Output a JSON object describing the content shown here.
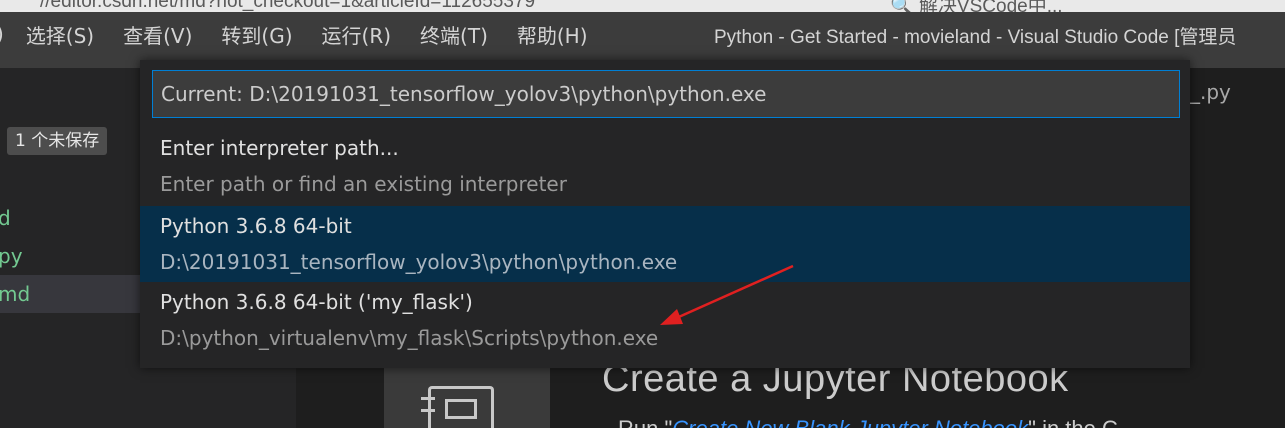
{
  "browser_strip": {
    "ghost_left": "//editor.csdn.net/md?not_checkout=1&articleId=112655379",
    "ghost_right": "🔍  解决VSCode中..."
  },
  "menubar": {
    "items": [
      ")",
      "选择(S)",
      "查看(V)",
      "转到(G)",
      "运行(R)",
      "终端(T)",
      "帮助(H)"
    ]
  },
  "window": {
    "title": "Python - Get Started - movieland - Visual Studio Code [管理员"
  },
  "sidebar": {
    "unsaved_badge": "1 个未保存",
    "files": [
      {
        "label": "d",
        "active": false
      },
      {
        "label": "py",
        "active": false
      },
      {
        "label": "md",
        "active": true
      }
    ]
  },
  "editor": {
    "tab_fragment": "_.py",
    "welcome_heading": "Create a Jupyter Notebook",
    "welcome_subline_prefix": "Run \"",
    "welcome_subline_link": "Create New Blank Jupyter Notebook",
    "welcome_subline_suffix": "\" in the C"
  },
  "quickpick": {
    "input_value": "Current: D:\\20191031_tensorflow_yolov3\\python\\python.exe",
    "items": [
      {
        "label": "Enter interpreter path...",
        "detail": "Enter path or find an existing interpreter",
        "selected": false
      },
      {
        "label": "Python 3.6.8 64-bit",
        "detail": "D:\\20191031_tensorflow_yolov3\\python\\python.exe",
        "selected": true
      },
      {
        "label": "Python 3.6.8 64-bit ('my_flask')",
        "detail": "D:\\python_virtualenv\\my_flask\\Scripts\\python.exe",
        "selected": false
      }
    ]
  },
  "colors": {
    "accent_focus": "#007fd4",
    "selected_item_bg": "#062f4a",
    "annotation_arrow": "#e02020",
    "git_untracked": "#73c991"
  }
}
